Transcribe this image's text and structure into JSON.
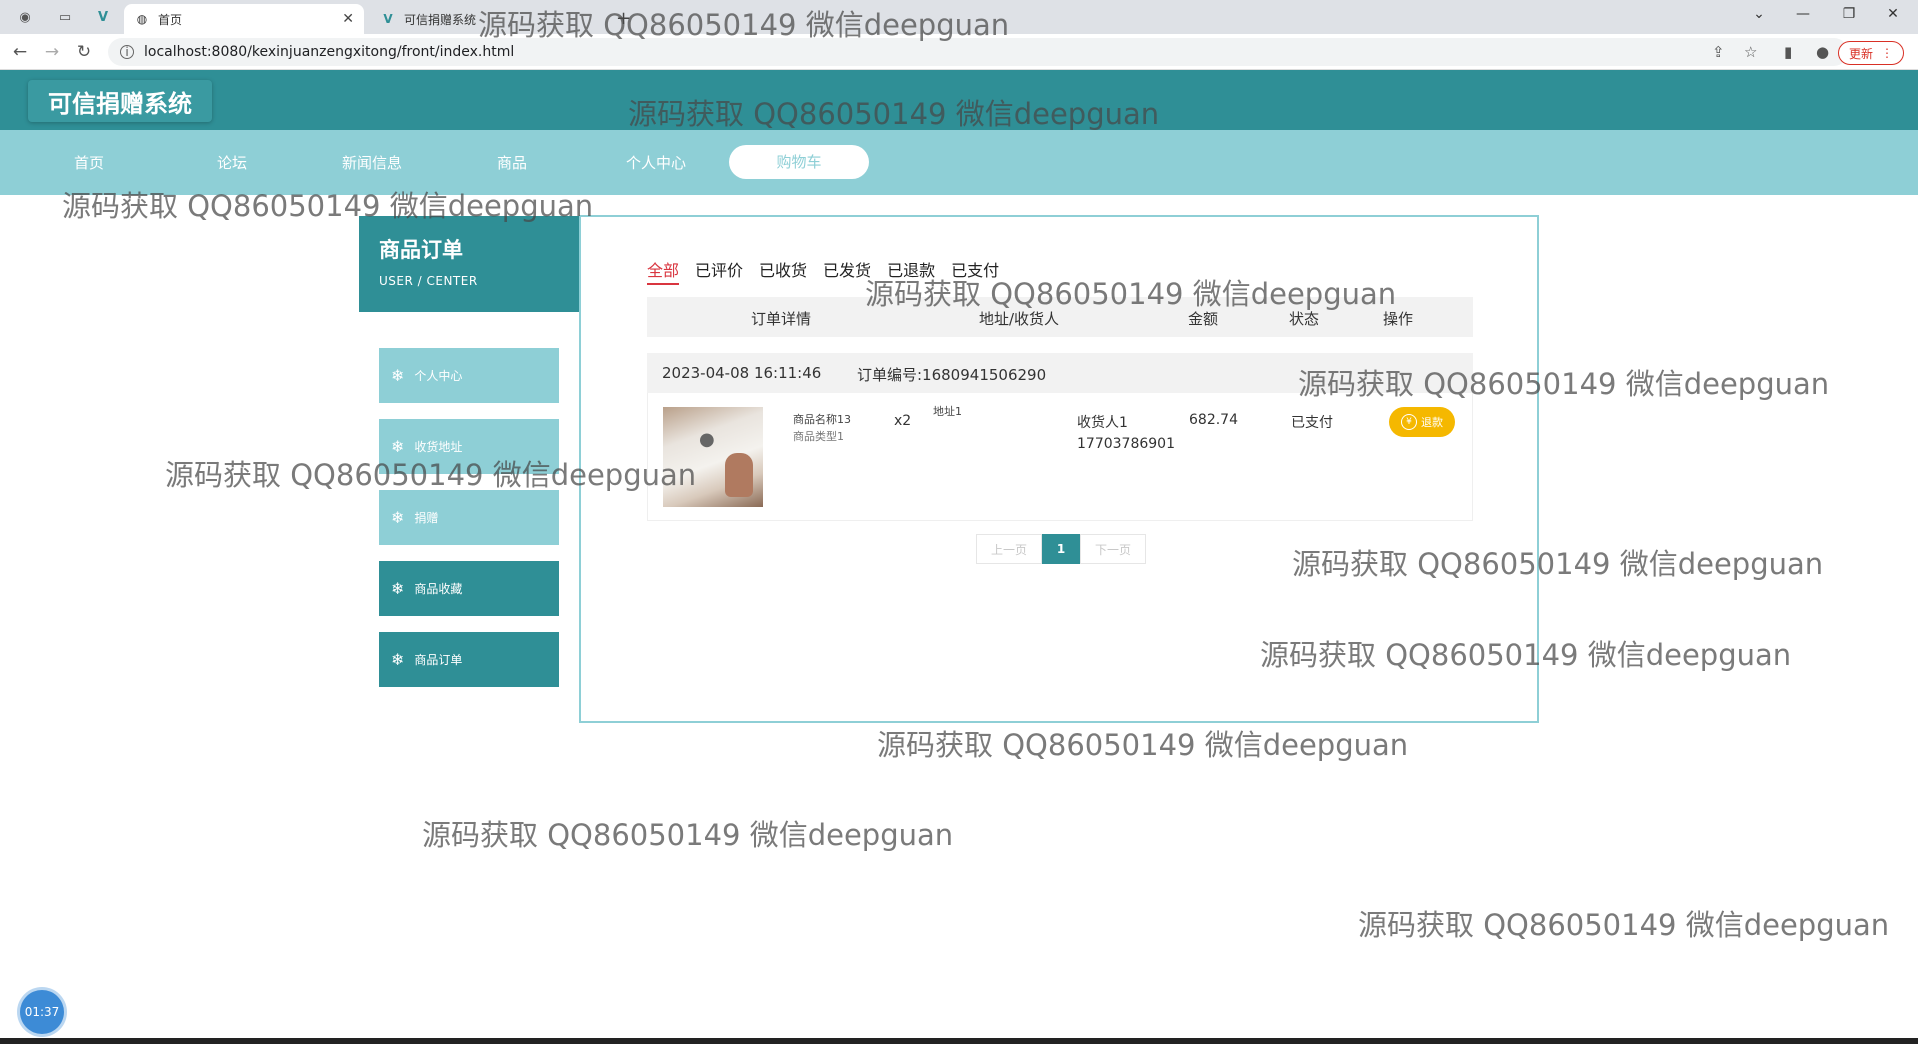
{
  "browser": {
    "tabs": [
      {
        "title": "首页",
        "active": true
      },
      {
        "title": "可信捐赠系统",
        "active": false
      }
    ],
    "url": "localhost:8080/kexinjuanzengxitong/front/index.html",
    "update_label": "更新"
  },
  "site": {
    "logo": "可信捐赠系统",
    "nav": [
      "首页",
      "论坛",
      "新闻信息",
      "商品",
      "个人中心",
      "购物车"
    ],
    "active_nav_index": 5
  },
  "sidebar": {
    "title": "商品订单",
    "subtitle": "USER / CENTER",
    "items": [
      "个人中心",
      "收货地址",
      "捐赠",
      "商品收藏",
      "商品订单"
    ]
  },
  "orders": {
    "status_tabs": [
      "全部",
      "已评价",
      "已收货",
      "已发货",
      "已退款",
      "已支付"
    ],
    "active_status": 0,
    "columns": [
      "订单详情",
      "地址/收货人",
      "金额",
      "状态",
      "操作"
    ],
    "list": [
      {
        "time": "2023-04-08 16:11:46",
        "order_no": "订单编号:1680941506290",
        "product_name": "商品名称13",
        "product_type": "商品类型1",
        "quantity": "x2",
        "address": "地址1",
        "receiver": "收货人1",
        "phone": "17703786901",
        "amount": "682.74",
        "status": "已支付",
        "action": "退款"
      }
    ]
  },
  "pagination": {
    "prev": "上一页",
    "current": "1",
    "next": "下一页"
  },
  "watermark": "源码获取 QQ86050149 微信deepguan",
  "timer": "01:37",
  "colors": {
    "primary": "#2f8f96",
    "light": "#8ecfd6",
    "accent_red": "#d9353f",
    "refund": "#f5b800"
  }
}
